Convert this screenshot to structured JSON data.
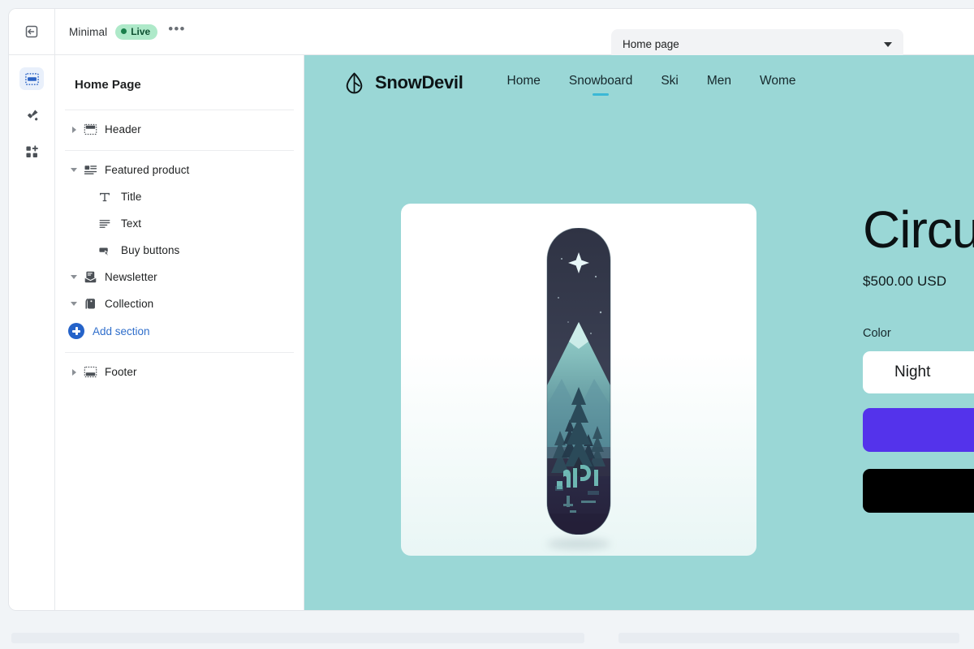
{
  "topbar": {
    "exit_icon": "exit-back-icon",
    "theme_name": "Minimal",
    "status_badge": "Live",
    "more_label": "•••",
    "page_selector": {
      "value": "Home page",
      "caret_icon": "chevron-down-icon"
    }
  },
  "rail": {
    "items": [
      {
        "icon": "sections-icon",
        "name": "sections",
        "active": true
      },
      {
        "icon": "paint-brush-icon",
        "name": "theme-settings",
        "active": false
      },
      {
        "icon": "apps-add-icon",
        "name": "apps",
        "active": false
      }
    ]
  },
  "sidebar": {
    "title": "Home Page",
    "add_section_label": "Add section",
    "add_section_icon": "plus-circle-icon",
    "groups": [
      {
        "items": [
          {
            "label": "Header",
            "icon": "header-layout-icon",
            "expanded": false,
            "child": false
          }
        ]
      },
      {
        "items": [
          {
            "label": "Featured product",
            "icon": "featured-product-icon",
            "expanded": true,
            "child": false
          },
          {
            "label": "Title",
            "icon": "text-title-icon",
            "child": true
          },
          {
            "label": "Text",
            "icon": "text-lines-icon",
            "child": true
          },
          {
            "label": "Buy buttons",
            "icon": "buy-button-icon",
            "child": true
          },
          {
            "label": "Newsletter",
            "icon": "newsletter-icon",
            "expanded": true,
            "child": false
          },
          {
            "label": "Collection",
            "icon": "collection-tag-icon",
            "expanded": true,
            "child": false
          }
        ]
      },
      {
        "items": [
          {
            "label": "Footer",
            "icon": "footer-layout-icon",
            "expanded": false,
            "child": false
          }
        ]
      }
    ]
  },
  "preview": {
    "background_color": "#9ad7d6",
    "store": {
      "logo_icon": "snowdevil-droplet-icon",
      "brand_name": "SnowDevil",
      "nav": [
        {
          "label": "Home",
          "active": false
        },
        {
          "label": "Snowboard",
          "active": true
        },
        {
          "label": "Ski",
          "active": false
        },
        {
          "label": "Men",
          "active": false
        },
        {
          "label": "Wome",
          "active": false
        }
      ]
    },
    "product": {
      "image_alt": "snowboard-night-design",
      "title": "Circu",
      "price": "$500.00 USD",
      "option_label": "Color",
      "option_value": "Night",
      "primary_button_color": "#5433eb",
      "secondary_button_color": "#000000"
    }
  }
}
